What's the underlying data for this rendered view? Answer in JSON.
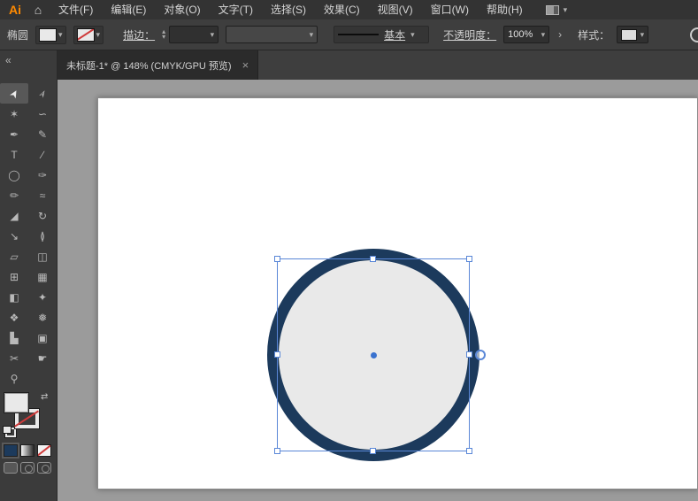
{
  "app": {
    "logo": "Ai",
    "home_icon": "⌂"
  },
  "icons": {
    "caret": "▾",
    "stepper_up": "▴",
    "stepper_down": "▾",
    "panel_arrow": "›",
    "swap": "⇄",
    "collapse": "«"
  },
  "menubar": {
    "items": [
      "文件(F)",
      "编辑(E)",
      "对象(O)",
      "文字(T)",
      "选择(S)",
      "效果(C)",
      "视图(V)",
      "窗口(W)",
      "帮助(H)"
    ]
  },
  "controlbar": {
    "tool_label": "椭圆",
    "stroke_label": "描边：",
    "stroke_value": "",
    "basic_label": "基本",
    "opacity_label": "不透明度：",
    "opacity_value": "100%",
    "style_label": "样式："
  },
  "tabbar": {
    "title": "未标题-1* @ 148% (CMYK/GPU 预览)",
    "close_icon": "×"
  },
  "toolbar": {
    "tools": [
      {
        "name": "selection-tool",
        "glyph": "➤",
        "active": true
      },
      {
        "name": "direct-selection-tool",
        "glyph": "➢",
        "active": false
      },
      {
        "name": "magic-wand-tool",
        "glyph": "✶",
        "active": false
      },
      {
        "name": "lasso-tool",
        "glyph": "∽",
        "active": false
      },
      {
        "name": "pen-tool",
        "glyph": "✒",
        "active": false
      },
      {
        "name": "curvature-tool",
        "glyph": "✎",
        "active": false
      },
      {
        "name": "type-tool",
        "glyph": "T",
        "active": false
      },
      {
        "name": "line-segment-tool",
        "glyph": "∕",
        "active": false
      },
      {
        "name": "ellipse-tool",
        "glyph": "◯",
        "active": false
      },
      {
        "name": "paintbrush-tool",
        "glyph": "✑",
        "active": false
      },
      {
        "name": "pencil-tool",
        "glyph": "✏",
        "active": false
      },
      {
        "name": "shaper-tool",
        "glyph": "≈",
        "active": false
      },
      {
        "name": "eraser-tool",
        "glyph": "◢",
        "active": false
      },
      {
        "name": "rotate-tool",
        "glyph": "↻",
        "active": false
      },
      {
        "name": "scale-tool",
        "glyph": "↘",
        "active": false
      },
      {
        "name": "width-tool",
        "glyph": "≬",
        "active": false
      },
      {
        "name": "free-transform-tool",
        "glyph": "▱",
        "active": false
      },
      {
        "name": "shape-builder-tool",
        "glyph": "◫",
        "active": false
      },
      {
        "name": "perspective-grid-tool",
        "glyph": "⊞",
        "active": false
      },
      {
        "name": "mesh-tool",
        "glyph": "▦",
        "active": false
      },
      {
        "name": "gradient-tool",
        "glyph": "◧",
        "active": false
      },
      {
        "name": "eyedropper-tool",
        "glyph": "✦",
        "active": false
      },
      {
        "name": "blend-tool",
        "glyph": "❖",
        "active": false
      },
      {
        "name": "symbol-sprayer-tool",
        "glyph": "❅",
        "active": false
      },
      {
        "name": "column-graph-tool",
        "glyph": "▙",
        "active": false
      },
      {
        "name": "artboard-tool",
        "glyph": "▣",
        "active": false
      },
      {
        "name": "slice-tool",
        "glyph": "✂",
        "active": false
      },
      {
        "name": "hand-tool",
        "glyph": "☛",
        "active": false
      },
      {
        "name": "zoom-tool",
        "glyph": "⚲",
        "active": false
      }
    ]
  },
  "shape": {
    "ring_color": "#1c3a5c",
    "fill_color": "#e9e9e9",
    "selection_color": "#5a87d7"
  }
}
